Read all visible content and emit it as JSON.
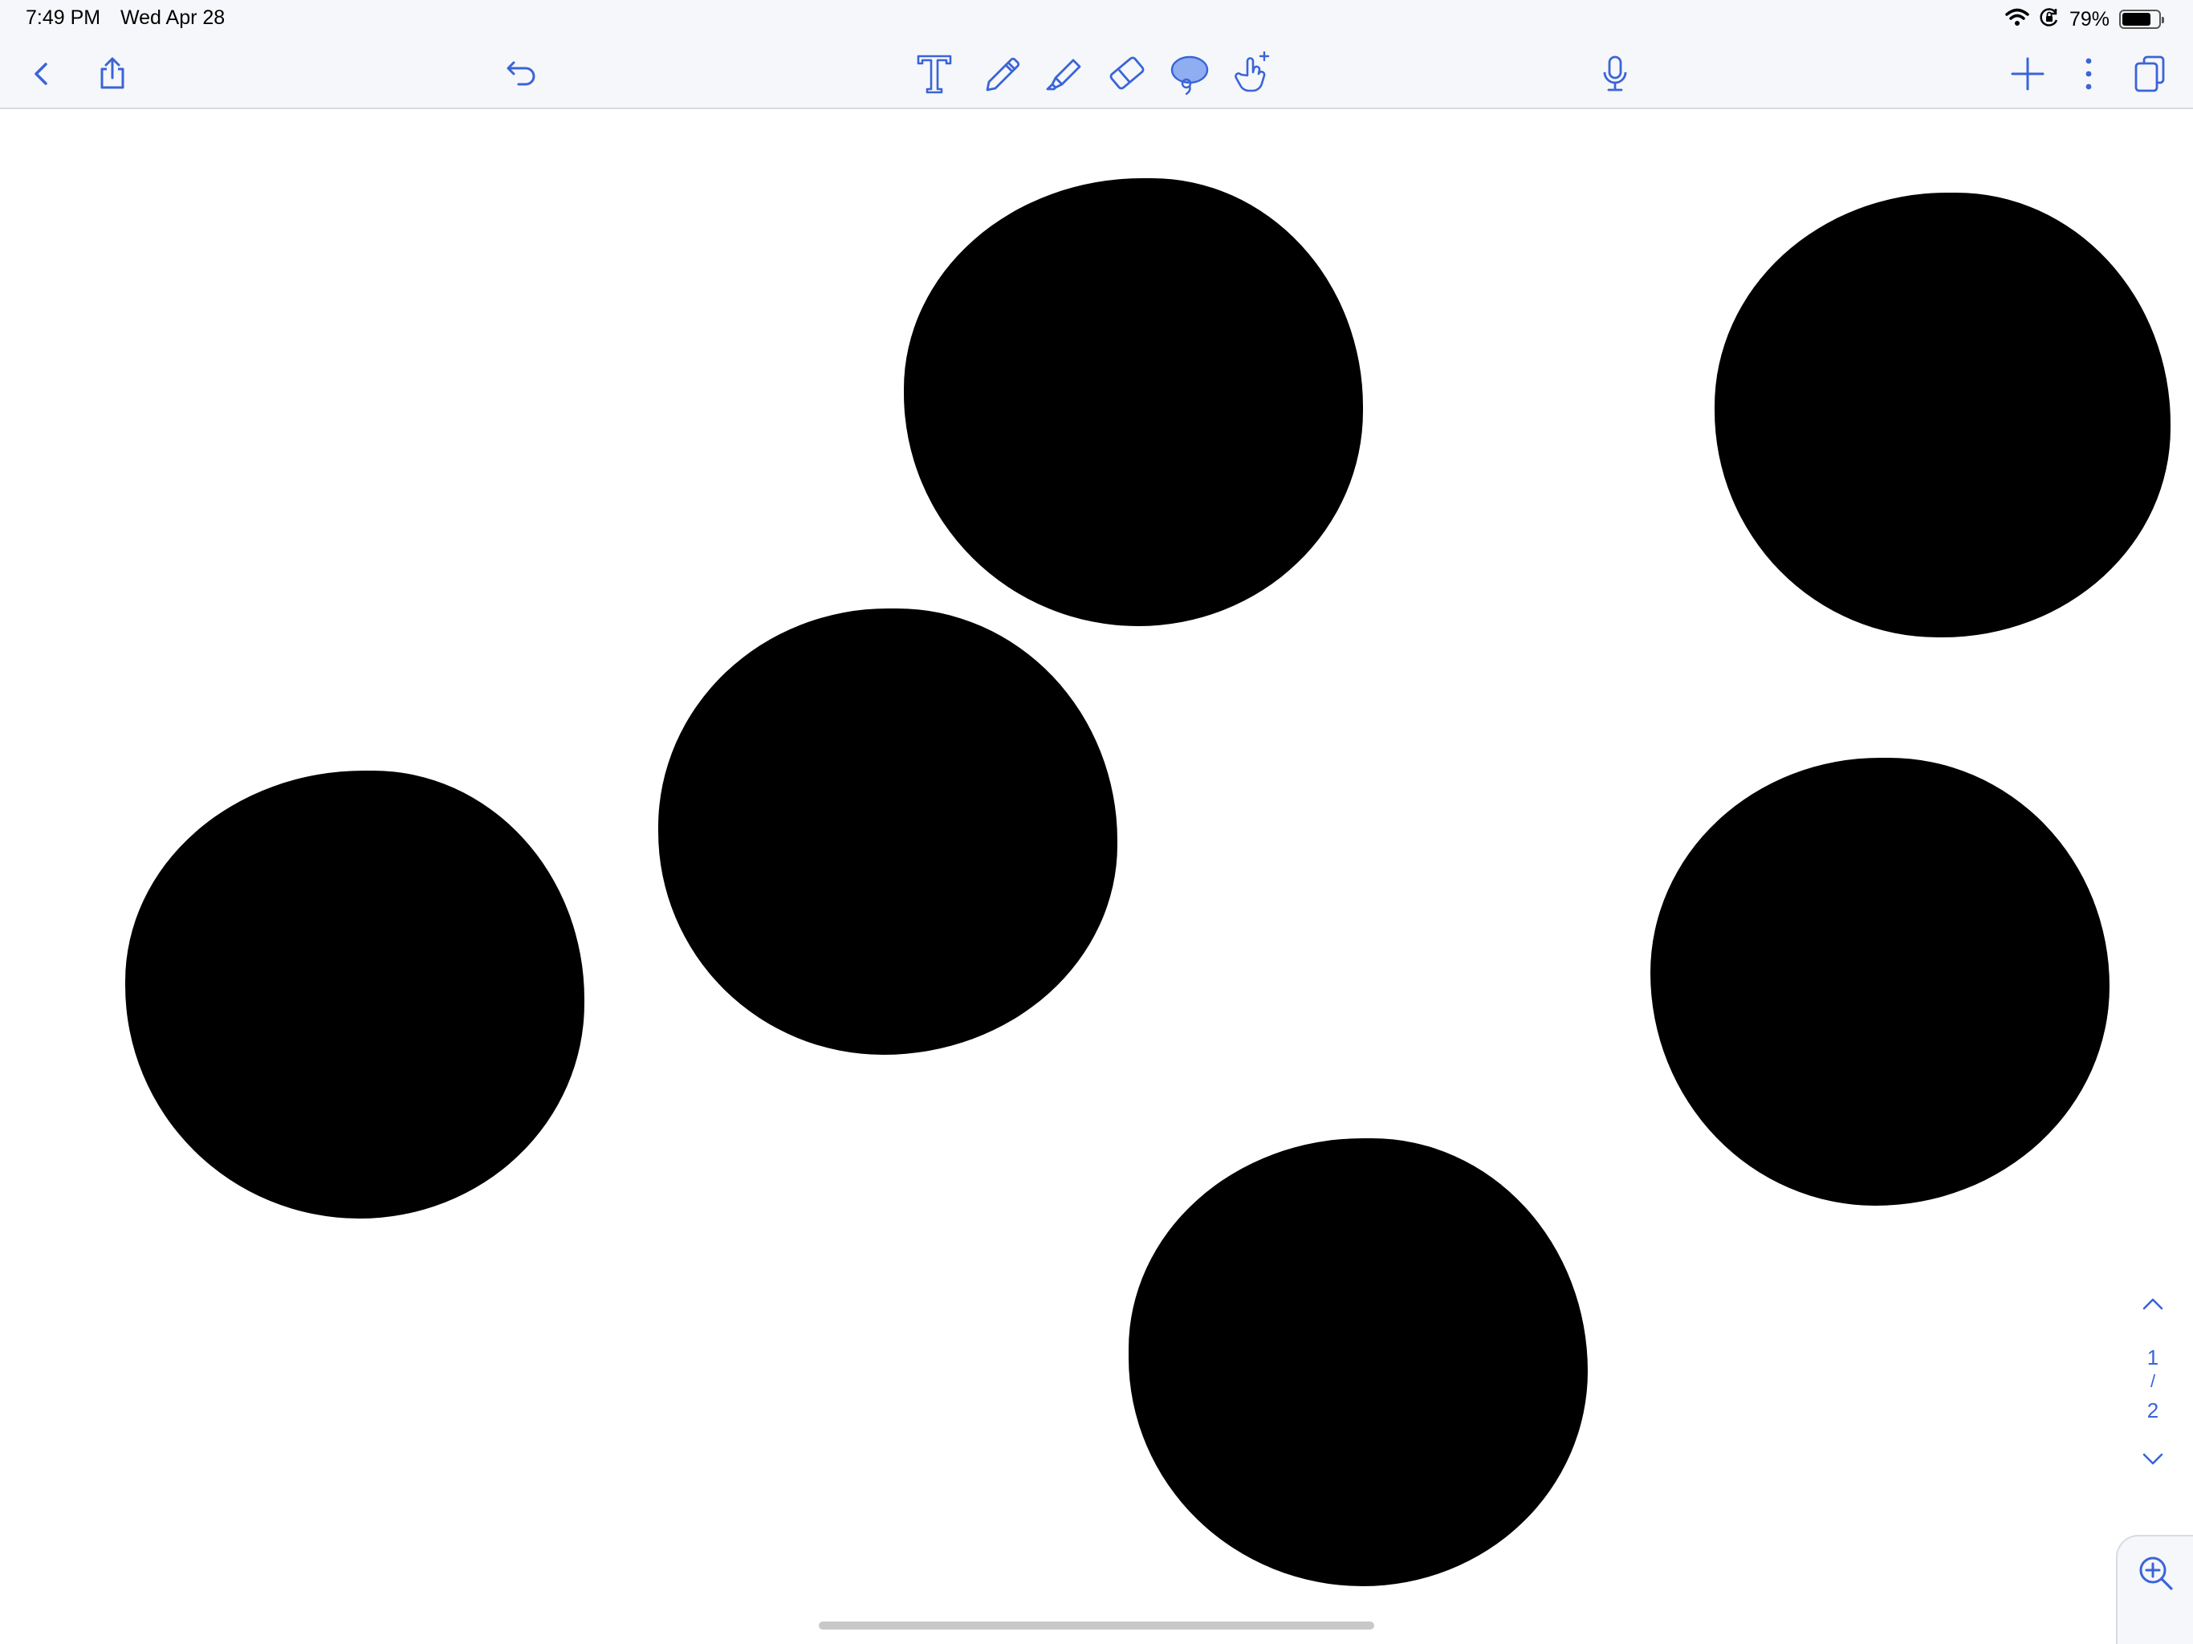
{
  "status_bar": {
    "time": "7:49 PM",
    "date": "Wed Apr 28",
    "battery_percent_label": "79%",
    "battery_level": 0.79,
    "icons": [
      "wifi-icon",
      "orientation-lock-icon",
      "battery-icon"
    ]
  },
  "toolbar": {
    "left": [
      "back-icon",
      "share-icon",
      "undo-icon"
    ],
    "tools": [
      "text-tool-icon",
      "pen-tool-icon",
      "highlighter-tool-icon",
      "eraser-tool-icon",
      "lasso-tool-icon",
      "hand-tool-icon"
    ],
    "selected_tool": "lasso-tool-icon",
    "right": [
      "microphone-icon",
      "add-page-icon",
      "more-options-icon",
      "pages-overview-icon"
    ],
    "accent_color": "#3a64d8",
    "selected_fill": "#8faef2"
  },
  "canvas": {
    "background": "#ffffff",
    "ink_color": "#000000",
    "blob_count": 6
  },
  "page_nav": {
    "current_page": "1",
    "separator": "/",
    "total_pages": "2"
  },
  "zoom": {
    "icon": "zoom-in-icon"
  }
}
